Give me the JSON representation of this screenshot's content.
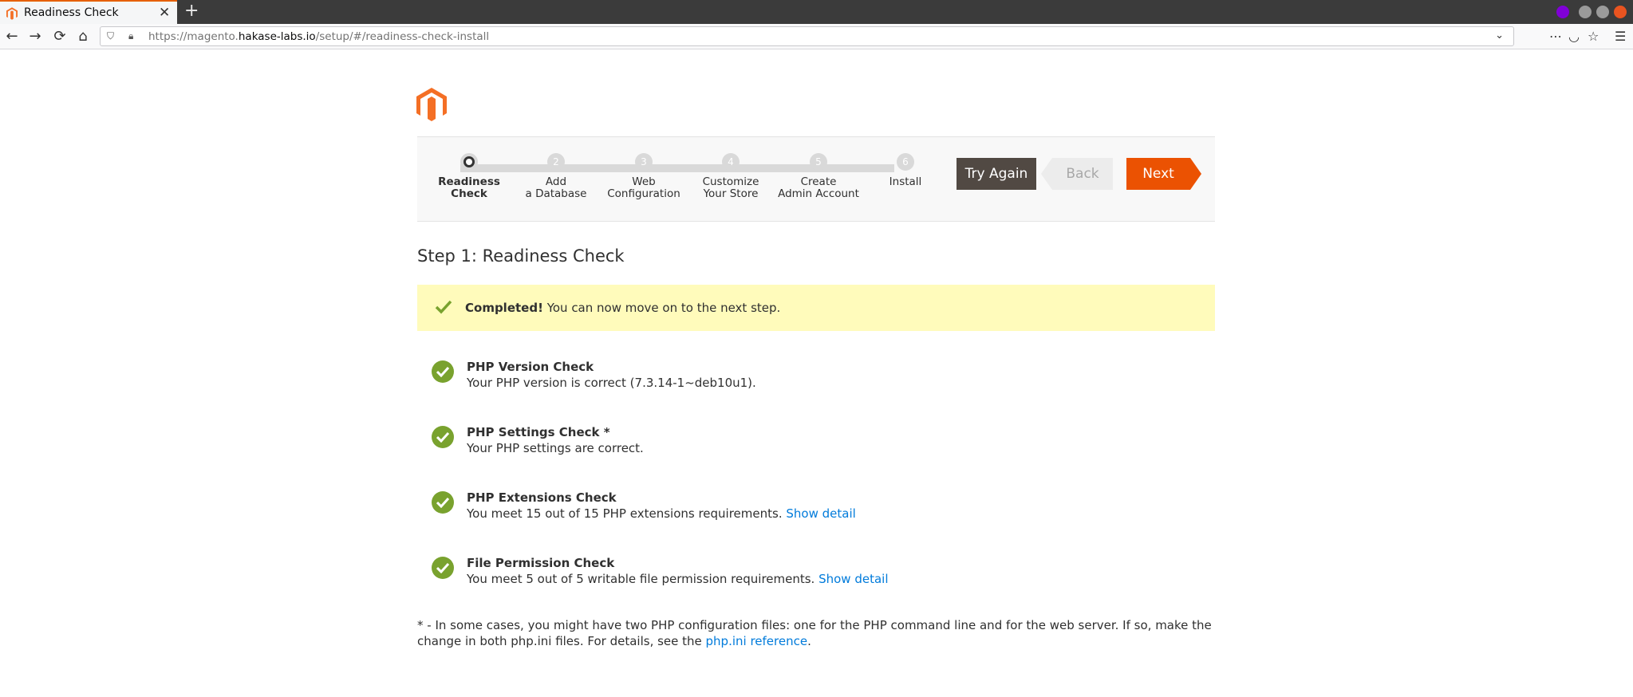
{
  "browser": {
    "tab_title": "Readiness Check",
    "tab_close": "✕",
    "new_tab": "+",
    "url_prefix": "https://magento.",
    "url_domain": "hakase-labs.io",
    "url_path": "/setup/#/readiness-check-install"
  },
  "wizard": {
    "steps": [
      {
        "number": "",
        "label": "Readiness\nCheck",
        "active": true
      },
      {
        "number": "2",
        "label": "Add\na Database",
        "active": false
      },
      {
        "number": "3",
        "label": "Web\nConfiguration",
        "active": false
      },
      {
        "number": "4",
        "label": "Customize\nYour Store",
        "active": false
      },
      {
        "number": "5",
        "label": "Create\nAdmin Account",
        "active": false
      },
      {
        "number": "6",
        "label": "Install",
        "active": false
      }
    ],
    "try_again_label": "Try Again",
    "back_label": "Back",
    "next_label": "Next"
  },
  "main": {
    "title": "Step 1: Readiness Check",
    "notice_strong": "Completed!",
    "notice_text": " You can now move on to the next step.",
    "checks": [
      {
        "title": "PHP Version Check",
        "desc": "Your PHP version is correct (7.3.14-1~deb10u1).",
        "link": ""
      },
      {
        "title": "PHP Settings Check *",
        "desc": "Your PHP settings are correct.",
        "link": ""
      },
      {
        "title": "PHP Extensions Check",
        "desc": "You meet 15 out of 15 PHP extensions requirements. ",
        "link": "Show detail"
      },
      {
        "title": "File Permission Check",
        "desc": "You meet 5 out of 5 writable file permission requirements. ",
        "link": "Show detail"
      }
    ],
    "footnote_text": "* - In some cases, you might have two PHP configuration files: one for the PHP command line and for the web server. If so, make the change in both php.ini files. For details, see the ",
    "footnote_link": "php.ini reference",
    "footnote_end": "."
  },
  "colors": {
    "brand_orange": "#eb5202",
    "success_green": "#79a22e",
    "notice_bg": "#fffbbb",
    "link_blue": "#007bdb"
  }
}
